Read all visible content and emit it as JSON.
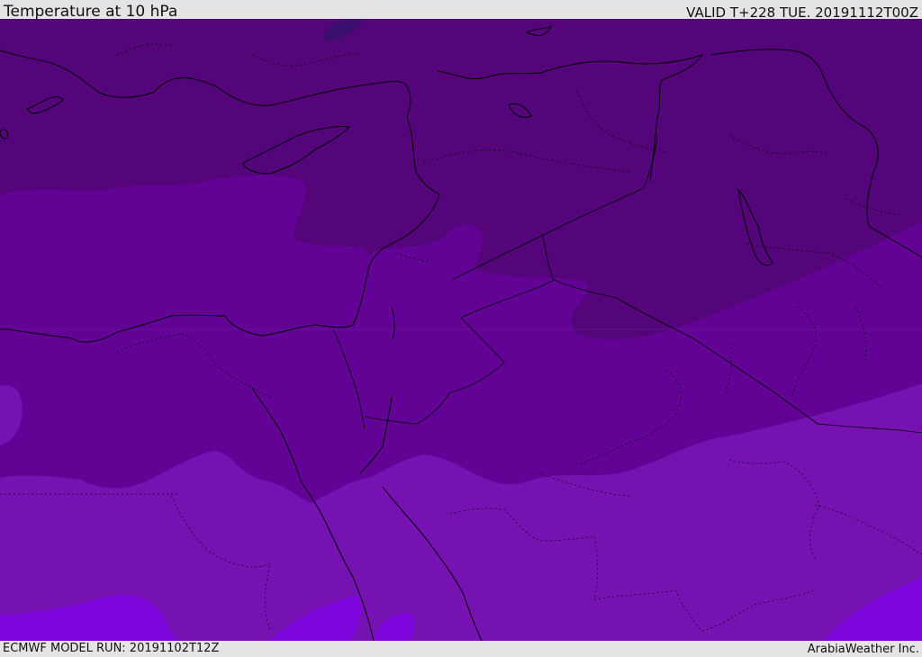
{
  "header": {
    "title": "Temperature at 10 hPa",
    "valid": "VALID T+228 TUE. 20191112T00Z"
  },
  "footer": {
    "model_run": "ECMWF MODEL RUN: 20191102T12Z",
    "credit": "ArabiaWeather Inc."
  },
  "colors": {
    "darkest": "#3a0f6e",
    "dark": "#540579",
    "mid": "#620396",
    "light": "#7612b2",
    "lightest": "#7d07dd",
    "boundary": "#000000"
  }
}
